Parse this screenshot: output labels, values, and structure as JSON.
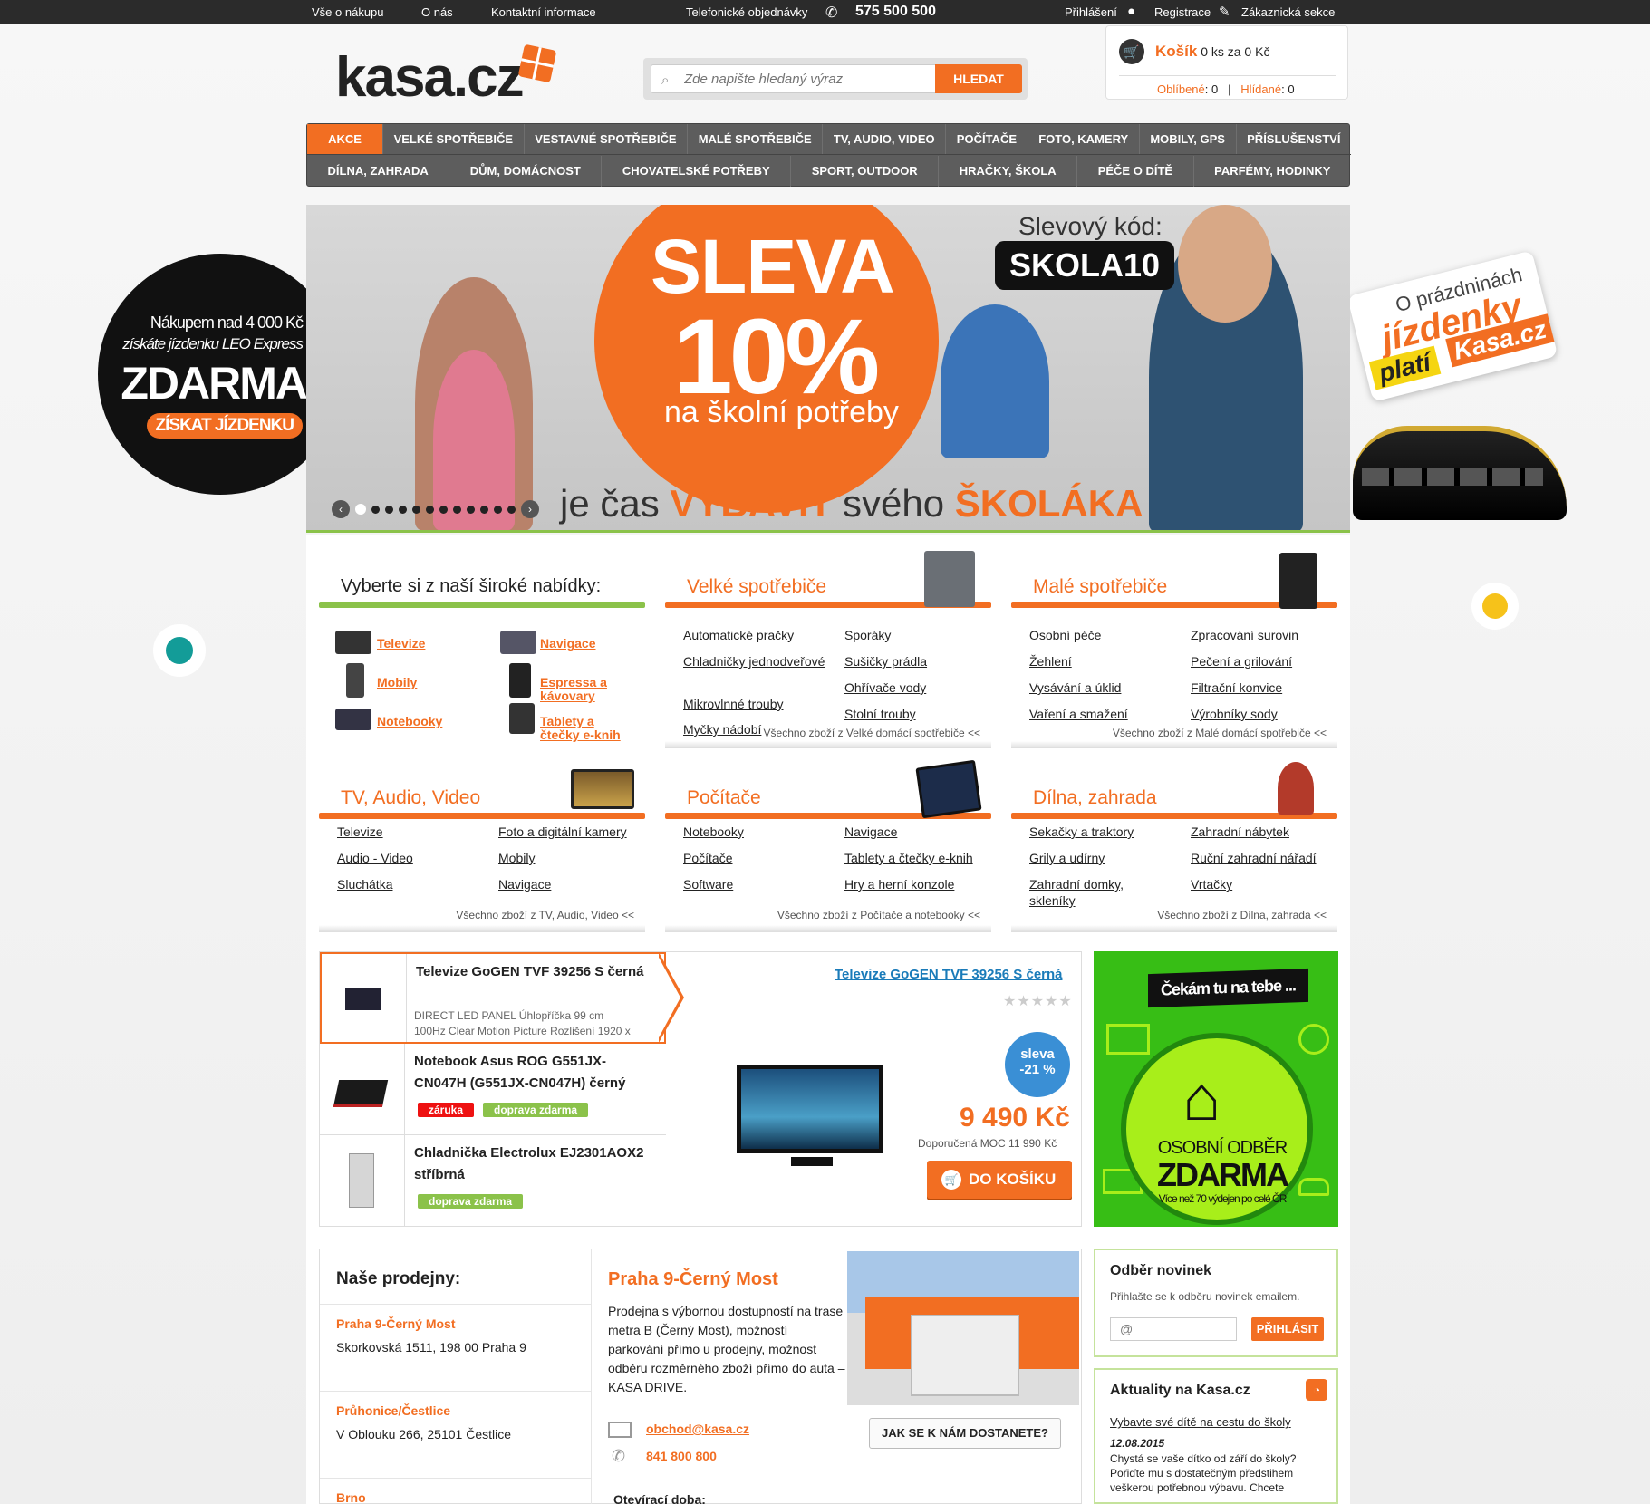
{
  "topbar": {
    "vse_o_nakupu": "Vše o nákupu",
    "o_nas": "O nás",
    "kontakt": "Kontaktní informace",
    "tel_label": "Telefonické objednávky",
    "tel_number": "575 500 500",
    "login": "Přihlášení",
    "register": "Registrace",
    "customer": "Zákaznická sekce"
  },
  "header": {
    "logo": "kasa.cz",
    "search_placeholder": "Zde napište hledaný výraz",
    "search_button": "HLEDAT"
  },
  "cart": {
    "label": "Košík",
    "summary": "0 ks za 0 Kč",
    "fav_label": "Oblíbené",
    "fav_count": ": 0",
    "watched_label": "Hlídané",
    "watched_count": ": 0"
  },
  "nav": {
    "row1": [
      "AKCE",
      "VELKÉ SPOTŘEBIČE",
      "VESTAVNÉ SPOTŘEBIČE",
      "MALÉ SPOTŘEBIČE",
      "TV, AUDIO, VIDEO",
      "POČÍTAČE",
      "FOTO, KAMERY",
      "MOBILY, GPS",
      "PŘÍSLUŠENSTVÍ"
    ],
    "row2": [
      "DÍLNA, ZAHRADA",
      "DŮM, DOMÁCNOST",
      "CHOVATELSKÉ POTŘEBY",
      "SPORT, OUTDOOR",
      "HRAČKY, ŠKOLA",
      "PÉČE O DÍTĚ",
      "PARFÉMY, HODINKY"
    ]
  },
  "banner": {
    "sleva": "SLEVA",
    "percent": "10%",
    "subtitle": "na školní potřeby",
    "code_label": "Slevový kód:",
    "code": "SKOLA10",
    "bottom_pre": "je čas ",
    "bottom_b1": "VYBAVIT",
    "bottom_mid": " svého ",
    "bottom_b2": "ŠKOLÁKA"
  },
  "left_promo": {
    "line1": "Nákupem nad 4 000 Kč",
    "line2": "získáte jízdenku LEO Express",
    "line3": "ZDARMA",
    "button": "ZÍSKAT JÍZDENKU"
  },
  "right_promo": {
    "line1": "O prázdninách",
    "line2": "jízdenky",
    "line3": "platí",
    "line4": "Kasa.cz"
  },
  "offer": {
    "title": "Vyberte si z naší široké nabídky:",
    "items": [
      "Televize",
      "Navigace",
      "Mobily",
      "Espressa a kávovary",
      "Notebooky",
      "Tablety a čtečky e-knih"
    ]
  },
  "categories": [
    {
      "title": "Velké spotřebiče",
      "col1": [
        "Automatické pračky",
        "Chladničky jednodveřové",
        "Mikrovlnné trouby",
        "Myčky nádobí"
      ],
      "col2": [
        "Sporáky",
        "Sušičky prádla",
        "Ohřívače vody",
        "Stolní trouby"
      ],
      "all": "Všechno zboží z Velké domácí spotřebiče <<"
    },
    {
      "title": "Malé spotřebiče",
      "col1": [
        "Osobní péče",
        "Žehlení",
        "Vysávání a úklid",
        "Vaření a smažení"
      ],
      "col2": [
        "Zpracování surovin",
        "Pečení a grilování",
        "Filtrační konvice",
        "Výrobníky sody"
      ],
      "all": "Všechno zboží z Malé domácí spotřebiče <<"
    },
    {
      "title": "TV, Audio, Video",
      "col1": [
        "Televize",
        "Audio - Video",
        "Sluchátka"
      ],
      "col2": [
        "Foto a digitální kamery",
        "Mobily",
        "Navigace"
      ],
      "all": "Všechno zboží z TV, Audio, Video <<"
    },
    {
      "title": "Počítače",
      "col1": [
        "Notebooky",
        "Počítače",
        "Software"
      ],
      "col2": [
        "Navigace",
        "Tablety a čtečky e-knih",
        "Hry a herní konzole"
      ],
      "all": "Všechno zboží z Počítače a notebooky <<"
    },
    {
      "title": "Dílna, zahrada",
      "col1": [
        "Sekačky a traktory",
        "Grily a udírny",
        "Zahradní domky, skleníky"
      ],
      "col2": [
        "Zahradní nábytek",
        "Ruční zahradní nářadí",
        "Vrtačky"
      ],
      "all": "Všechno zboží z Dílna, zahrada <<"
    }
  ],
  "products": [
    {
      "title": "Televize GoGEN TVF 39256 S černá",
      "desc1": "DIRECT LED PANEL Úhlopříčka 99 cm",
      "desc2": "100Hz Clear Motion Picture Rozlišení 1920 x"
    },
    {
      "title1": "Notebook Asus ROG G551JX-",
      "title2": "CN047H (G551JX-CN047H) černý",
      "tag1": "záruka",
      "tag2": "doprava zdarma"
    },
    {
      "title1": "Chladnička Electrolux EJ2301AOX2",
      "title2": "stříbrná",
      "tag1": "doprava zdarma"
    }
  ],
  "featured": {
    "title": "Televize GoGEN TVF 39256 S černá",
    "stars": "★★★★★",
    "rating": 0,
    "badge1": "sleva",
    "badge2": "-21 %",
    "price": "9 490 Kč",
    "moc": "Doporučená MOC 11 990 Kč",
    "button": "DO KOŠÍKU"
  },
  "green_ad": {
    "header": "Čekám tu na tebe ...",
    "line1": "OSOBNÍ ODBĚR",
    "line2": "ZDARMA",
    "line3": "Více než 70 výdejen po celé ČR"
  },
  "stores": {
    "title": "Naše prodejny:",
    "list": [
      {
        "name": "Praha 9-Černý Most",
        "address": "Skorkovská 1511, 198 00 Praha 9"
      },
      {
        "name": "Průhonice/Čestlice",
        "address": "V Oblouku 266, 25101 Čestlice"
      },
      {
        "name": "Brno",
        "address": ""
      }
    ],
    "detail_title": "Praha 9-Černý Most",
    "detail_text": "Prodejna s výbornou dostupností na trase metra B (Černý Most), možností parkování přímo u prodejny, možnost odběru rozměrného zboží přímo do auta – KASA DRIVE.",
    "email": "obchod@kasa.cz",
    "phone": "841 800 800",
    "hours_label": "Otevírací doba:",
    "directions_button": "JAK SE K NÁM DOSTANETE?"
  },
  "newsletter": {
    "title": "Odběr novinek",
    "text": "Přihlašte se k odběru novinek emailem.",
    "placeholder": "@",
    "button": "PŘIHLÁSIT"
  },
  "news": {
    "title": "Aktuality na Kasa.cz",
    "link": "Vybavte své dítě na cestu do školy",
    "date": "12.08.2015",
    "text": "Chystá se vaše dítko od září do školy? Pořiďte mu s dostatečným předstihem veškerou potřebnou výbavu. Chcete"
  },
  "colors": {
    "accent": "#f26e22",
    "green": "#8bc24a",
    "ad_green": "#37be15",
    "nav_bg": "#5d5d5d",
    "topbar": "#2b2b2b"
  }
}
